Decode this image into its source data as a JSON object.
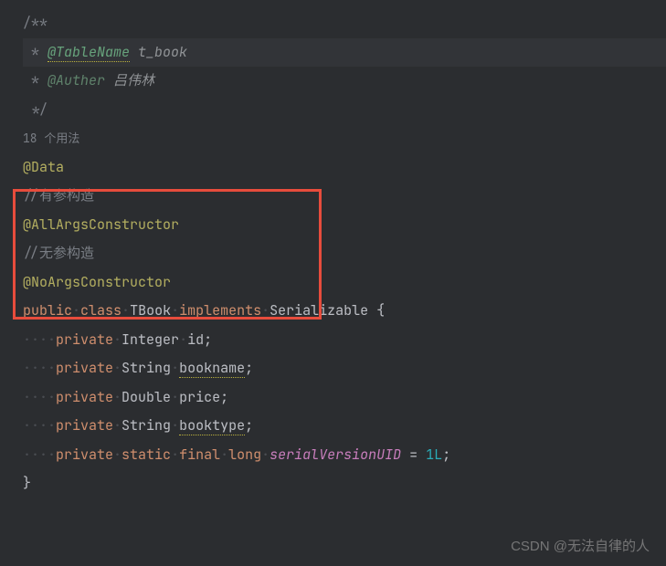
{
  "code": {
    "doc_open": "/**",
    "doc_star": " * ",
    "doc_tag1": "@TableName",
    "doc_val1": " t_book",
    "doc_tag2": "@Auther",
    "doc_val2": " 吕伟林",
    "doc_close": " */",
    "usages": "18 个用法",
    "anno_data": "@Data",
    "comment1": "//有参构造",
    "anno_allargs": "@AllArgsConstructor",
    "comment2": "//无参构造",
    "anno_noargs": "@NoArgsConstructor",
    "kw_public": "public",
    "kw_class": "class",
    "class_name": "TBook",
    "kw_implements": "implements",
    "iface": "Serializable",
    "brace_open": " {",
    "brace_close": "}",
    "kw_private": "private",
    "kw_static": "static",
    "kw_final": "final",
    "type_integer": "Integer",
    "type_string": "String",
    "type_double": "Double",
    "type_long": "long",
    "field_id": "id",
    "field_bookname": "bookname",
    "field_price": "price",
    "field_booktype": "booktype",
    "field_uid": "serialVersionUID",
    "eq": " = ",
    "val_1l": "1L",
    "semi": ";",
    "ws4": "····",
    "ws1": "·"
  },
  "watermark": "CSDN @无法自律的人"
}
